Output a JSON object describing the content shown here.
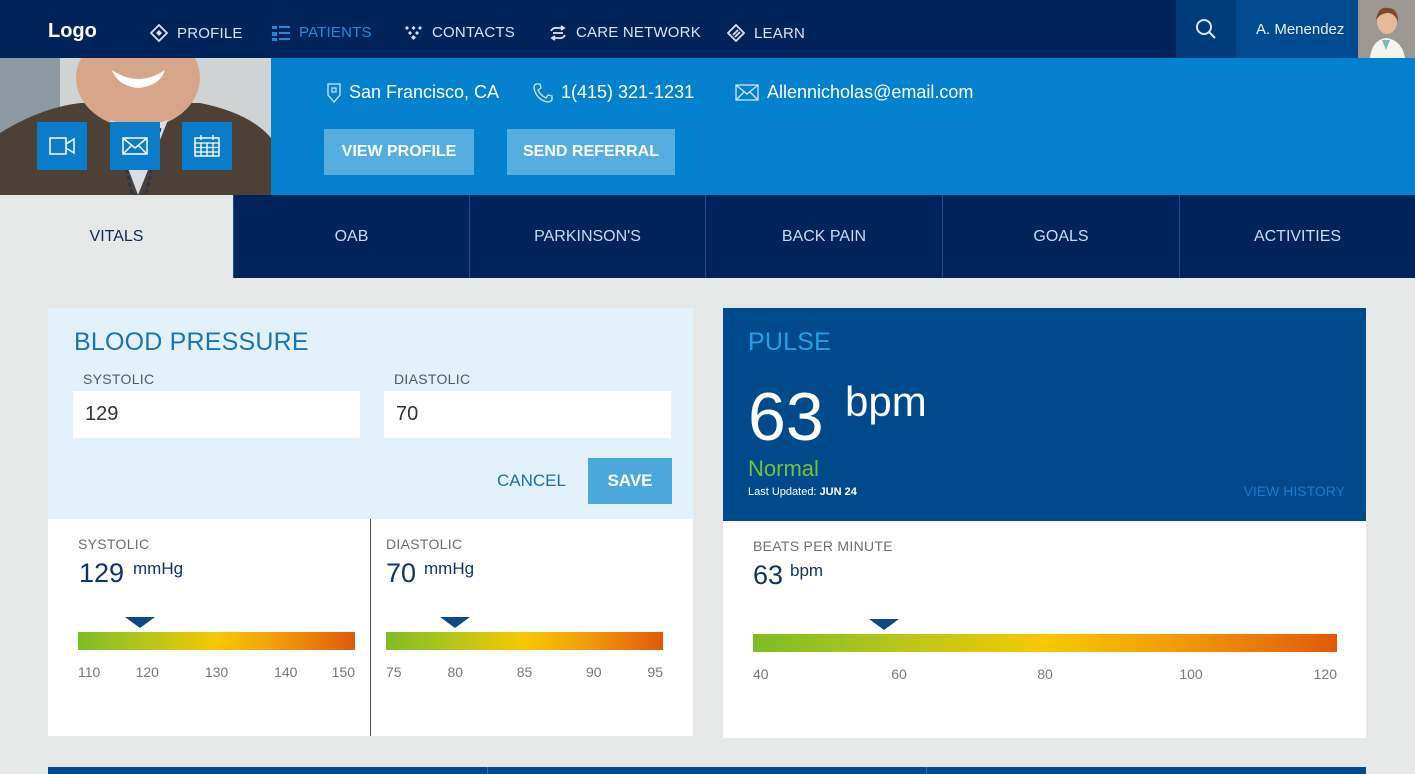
{
  "topnav": {
    "logo": "Logo",
    "items": [
      {
        "label": "PROFILE",
        "icon": "diamond-icon",
        "active": false
      },
      {
        "label": "PATIENTS",
        "icon": "list-icon",
        "active": true
      },
      {
        "label": "CONTACTS",
        "icon": "contacts-icon",
        "active": false
      },
      {
        "label": "CARE NETWORK",
        "icon": "care-network-icon",
        "active": false
      },
      {
        "label": "LEARN",
        "icon": "learn-icon",
        "active": false
      }
    ],
    "user_name": "A. Menendez"
  },
  "patient": {
    "location": "San Francisco, CA",
    "phone": "1(415) 321-1231",
    "email": "Allennicholas@email.com",
    "view_profile_label": "VIEW PROFILE",
    "send_referral_label": "SEND REFERRAL"
  },
  "tabs": [
    {
      "label": "VITALS",
      "active": true
    },
    {
      "label": "OAB",
      "active": false
    },
    {
      "label": "PARKINSON'S",
      "active": false
    },
    {
      "label": "BACK PAIN",
      "active": false
    },
    {
      "label": "GOALS",
      "active": false
    },
    {
      "label": "ACTIVITIES",
      "active": false
    }
  ],
  "blood_pressure": {
    "title": "BLOOD PRESSURE",
    "systolic_label": "SYSTOLIC",
    "diastolic_label": "DIASTOLIC",
    "systolic_input": "129",
    "diastolic_input": "70",
    "cancel_label": "CANCEL",
    "save_label": "SAVE",
    "systolic_gauge": {
      "label": "SYSTOLIC",
      "value": "129",
      "unit": "mmHg",
      "ticks": [
        "110",
        "120",
        "130",
        "140",
        "150"
      ],
      "min": 110,
      "max": 150,
      "marker_value": 119
    },
    "diastolic_gauge": {
      "label": "DIASTOLIC",
      "value": "70",
      "unit": "mmHg",
      "ticks": [
        "75",
        "80",
        "85",
        "90",
        "95"
      ],
      "min": 75,
      "max": 95,
      "marker_value": 80
    }
  },
  "pulse": {
    "title": "PULSE",
    "value": "63",
    "unit": "bpm",
    "status": "Normal",
    "last_updated_label": "Last Updated:",
    "last_updated_value": "JUN 24",
    "view_history_label": "VIEW HISTORY",
    "gauge": {
      "label": "BEATS PER MINUTE",
      "value": "63",
      "unit": "bpm",
      "ticks": [
        "40",
        "60",
        "80",
        "100",
        "120"
      ],
      "min": 40,
      "max": 120,
      "marker_value": 58
    }
  },
  "colors": {
    "nav_bg": "#00245a",
    "profile_bar": "#0381ce",
    "accent_blue": "#004a8c",
    "status_normal": "#74c043"
  }
}
